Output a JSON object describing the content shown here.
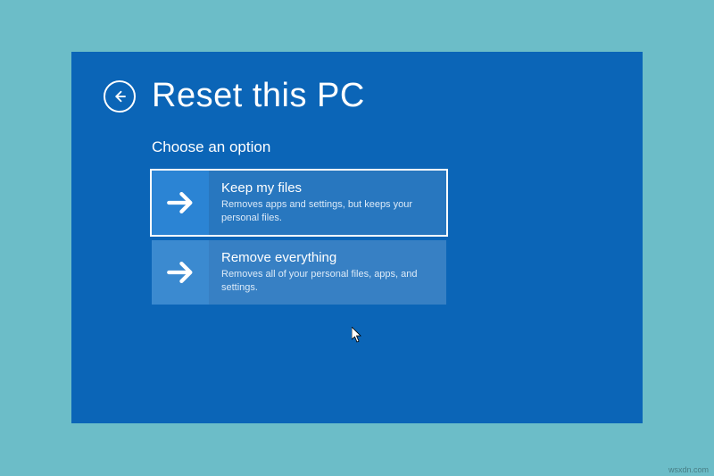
{
  "title": "Reset this PC",
  "subtitle": "Choose an option",
  "options": [
    {
      "title": "Keep my files",
      "desc": "Removes apps and settings, but keeps your personal files."
    },
    {
      "title": "Remove everything",
      "desc": "Removes all of your personal files, apps, and settings."
    }
  ],
  "watermark": "wsxdn.com"
}
